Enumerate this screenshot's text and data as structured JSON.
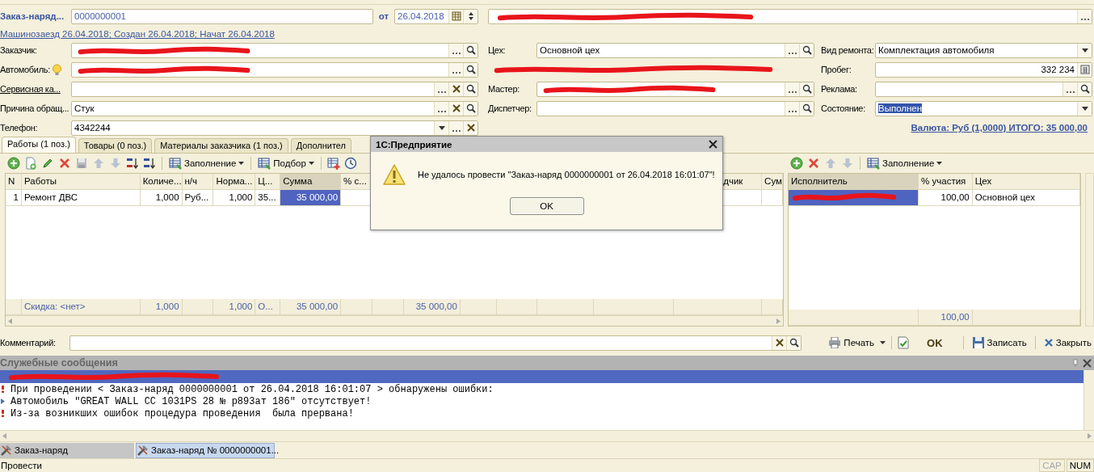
{
  "header": {
    "title": "Заказ-наряд...",
    "number": "0000000001",
    "date_label": "от",
    "date": "26.04.2018",
    "organization": {
      "redacted": true
    }
  },
  "info_link": "Машинозаезд 26.04.2018; Создан 26.04.2018; Начат 26.04.2018",
  "form": {
    "rows": [
      {
        "left": {
          "kind": "field",
          "label": "Заказчик:",
          "label_link": false,
          "field": {
            "redacted": true,
            "buttons": [
              {
                "kind": "more"
              },
              {
                "kind": "search"
              }
            ]
          }
        },
        "middle": {
          "kind": "field",
          "label": "Цех:",
          "label_link": false,
          "field": {
            "value": "Основной цех",
            "buttons": [
              {
                "kind": "more"
              },
              {
                "kind": "search"
              }
            ]
          }
        },
        "right": {
          "kind": "field",
          "label": "Вид ремонта:",
          "label_link": false,
          "field": {
            "value": "Комплектация автомобиля",
            "buttons": [
              {
                "kind": "dropdown"
              }
            ]
          }
        }
      },
      {
        "left": {
          "kind": "field",
          "label": "Автомобиль:",
          "label_link": false,
          "hint_icon": true,
          "field": {
            "redacted": true,
            "buttons": [
              {
                "kind": "more"
              },
              {
                "kind": "search"
              }
            ]
          }
        },
        "middle": {
          "kind": "link",
          "redacted": true
        },
        "right": {
          "kind": "field",
          "label": "Пробег:",
          "label_link": false,
          "field": {
            "value": "332 234",
            "numeric": true,
            "buttons": [
              {
                "kind": "calc"
              }
            ]
          }
        }
      },
      {
        "left": {
          "kind": "field",
          "label": "Сервисная ка...",
          "label_link": true,
          "field": {
            "buttons": [
              {
                "kind": "more"
              },
              {
                "kind": "clear"
              },
              {
                "kind": "search"
              }
            ]
          }
        },
        "middle": {
          "kind": "field",
          "label": "Мастер:",
          "label_link": false,
          "field": {
            "redacted": true,
            "buttons": [
              {
                "kind": "more"
              },
              {
                "kind": "search"
              }
            ]
          }
        },
        "right": {
          "kind": "field",
          "label": "Реклама:",
          "label_link": false,
          "field": {
            "buttons": [
              {
                "kind": "more"
              },
              {
                "kind": "search"
              }
            ]
          }
        }
      },
      {
        "left": {
          "kind": "field",
          "label": "Причина обращ...",
          "label_link": false,
          "field": {
            "value": "Стук",
            "buttons": [
              {
                "kind": "more"
              },
              {
                "kind": "clear"
              },
              {
                "kind": "search"
              }
            ]
          }
        },
        "middle": {
          "kind": "field",
          "label": "Диспетчер:",
          "label_link": false,
          "field": {
            "buttons": [
              {
                "kind": "more"
              },
              {
                "kind": "search"
              }
            ]
          }
        },
        "right": {
          "kind": "field",
          "label": "Состояние:",
          "label_link": false,
          "field": {
            "value": "Выполнен",
            "value_selected": true,
            "buttons": [
              {
                "kind": "dropdown"
              }
            ]
          }
        }
      },
      {
        "left": {
          "kind": "field",
          "label": "Телефон:",
          "label_link": false,
          "field": {
            "value": "4342244",
            "buttons": [
              {
                "kind": "dropdown"
              },
              {
                "kind": "more"
              },
              {
                "kind": "clear"
              }
            ]
          }
        },
        "right": {
          "kind": "total",
          "text": "Валюта: Руб (1,0000) ИТОГО: 35 000,00"
        }
      }
    ]
  },
  "tabs": [
    {
      "label": "Работы (1 поз.)",
      "selected": true
    },
    {
      "label": "Товары (0 поз.)",
      "selected": false
    },
    {
      "label": "Материалы заказчика (1 поз.)",
      "selected": false
    },
    {
      "label": "Дополнител",
      "selected": false
    }
  ],
  "toolbar": [
    {
      "kind": "add"
    },
    {
      "kind": "copy"
    },
    {
      "kind": "edit"
    },
    {
      "kind": "delete"
    },
    {
      "kind": "save"
    },
    {
      "kind": "up"
    },
    {
      "kind": "down"
    },
    {
      "kind": "sortup"
    },
    {
      "kind": "sortdown"
    },
    {
      "kind": "separator"
    },
    {
      "kind": "menu",
      "label": "Заполнение"
    },
    {
      "kind": "separator"
    },
    {
      "kind": "menu",
      "label": "Подбор"
    },
    {
      "kind": "separator"
    },
    {
      "kind": "tableadd"
    },
    {
      "kind": "clock"
    }
  ],
  "works_table": {
    "columns": [
      {
        "label": "N",
        "sorted": false
      },
      {
        "label": "Работы",
        "sorted": false
      },
      {
        "label": "Количе...",
        "sorted": false
      },
      {
        "label": "н/ч",
        "sorted": false
      },
      {
        "label": "Норма...",
        "sorted": false
      },
      {
        "label": "Ц...",
        "sorted": false
      },
      {
        "label": "Сумма",
        "sorted": true
      },
      {
        "label": "% с...",
        "sorted": false
      },
      {},
      {},
      {},
      {},
      {},
      {},
      {
        "label": "дчик",
        "sorted": false
      },
      {
        "label": "Сум",
        "sorted": false
      }
    ],
    "rows": [
      {
        "cells": [
          {
            "text": "1",
            "selected": false
          },
          {
            "text": "Ремонт ДВС",
            "selected": false
          },
          {
            "text": "1,000",
            "selected": false
          },
          {
            "text": "Руб...",
            "selected": false
          },
          {
            "text": "1,000",
            "selected": false
          },
          {
            "text": "35...",
            "selected": false
          },
          {
            "text": "35 000,00",
            "selected": true
          }
        ]
      }
    ],
    "totals": [
      {
        "text": "Скидка: <нет>"
      },
      {
        "text": "1,000"
      },
      {
        "text": "1,000"
      },
      {
        "text": "О..."
      },
      {
        "text": "35 000,00"
      },
      {
        "text": "35 000,00"
      }
    ]
  },
  "executors_toolbar": [
    {
      "kind": "add"
    },
    {
      "kind": "delete"
    },
    {
      "kind": "up"
    },
    {
      "kind": "down"
    },
    {
      "kind": "separator"
    },
    {
      "kind": "menu",
      "label": "Заполнение"
    }
  ],
  "executors_table": {
    "columns": [
      {
        "label": "Исполнитель",
        "sorted": true
      },
      {
        "label": "% участия",
        "sorted": false
      },
      {
        "label": "Цех",
        "sorted": false
      }
    ],
    "rows": [
      {
        "cells": [
          {
            "redacted": true,
            "selected": true
          },
          {
            "text": "100,00",
            "selected": false
          },
          {
            "text": "Основной цех",
            "selected": false
          }
        ]
      }
    ],
    "totals": [
      {
        "text": "100,00"
      }
    ]
  },
  "comment": {
    "label": "Комментарий:"
  },
  "actions": [
    {
      "kind": "print",
      "label": "Печать"
    },
    {
      "kind": "post"
    },
    {
      "kind": "ok",
      "label": "OK"
    },
    {
      "kind": "save",
      "label": "Записать"
    },
    {
      "kind": "close",
      "label": "Закрыть"
    }
  ],
  "messages": {
    "title": "Служебные сообщения",
    "selected_row": {
      "redacted": true
    },
    "lines": [
      {
        "kind": "error",
        "text": "При проведении < Заказ-наряд 0000000001 от 26.04.2018 16:01:07 > обнаружены ошибки:"
      },
      {
        "kind": "info",
        "text": "Автомобиль \"GREAT WALL CC 1031PS 28 № р893ат 186\" отсутствует!"
      },
      {
        "kind": "error",
        "text": "Из-за возникших ошибок процедура проведения  была прервана!"
      }
    ]
  },
  "taskbar": [
    {
      "label": "Заказ-наряд",
      "selected": false
    },
    {
      "label": "Заказ-наряд № 0000000001...",
      "selected": true
    }
  ],
  "status_bar": {
    "text": "Провести",
    "indicators": [
      {
        "label": "CAP",
        "on": false
      },
      {
        "label": "NUM",
        "on": true
      }
    ]
  },
  "dialog": {
    "title": "1С:Предприятие",
    "message": "Не удалось провести \"Заказ-наряд 0000000001 от 26.04.2018 16:01:07\"!",
    "button": "OK"
  }
}
